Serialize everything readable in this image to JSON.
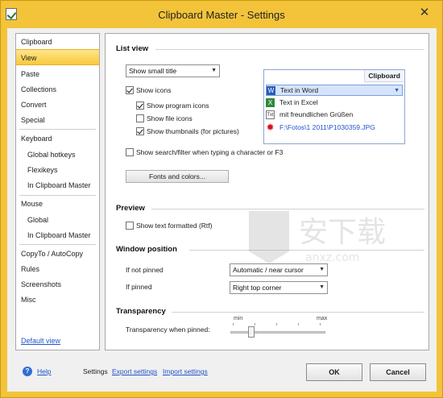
{
  "window": {
    "title": "Clipboard Master - Settings",
    "close_glyph": "✕"
  },
  "sidebar": {
    "items": [
      {
        "label": "Clipboard"
      },
      {
        "label": "View"
      },
      {
        "label": "Paste"
      },
      {
        "label": "Collections"
      },
      {
        "label": "Convert"
      },
      {
        "label": "Special"
      },
      {
        "label": "Keyboard"
      },
      {
        "label": "Global hotkeys"
      },
      {
        "label": "Flexikeys"
      },
      {
        "label": "In Clipboard Master"
      },
      {
        "label": "Mouse"
      },
      {
        "label": "Global"
      },
      {
        "label": "In Clipboard Master"
      },
      {
        "label": "CopyTo / AutoCopy"
      },
      {
        "label": "Rules"
      },
      {
        "label": "Screenshots"
      },
      {
        "label": "Misc"
      }
    ],
    "default_view": "Default view"
  },
  "list_view": {
    "title": "List view",
    "title_dropdown": "Show small title",
    "show_icons": "Show icons",
    "show_program_icons": "Show program icons",
    "show_file_icons": "Show file icons",
    "show_thumbnails": "Show thumbnails (for pictures)",
    "show_search": "Show search/filter when typing a character or F3",
    "fonts_button": "Fonts and colors..."
  },
  "preview_box": {
    "header": "Clipboard",
    "items": [
      {
        "text": "Text in Word",
        "icon": "word-icon"
      },
      {
        "text": "Text in Excel",
        "icon": "excel-icon"
      },
      {
        "text": "mit freundlichen Grüßen",
        "icon": "text-icon"
      },
      {
        "text": "F:\\Fotos\\1 2011\\P1030359.JPG",
        "icon": "paint-icon"
      }
    ]
  },
  "preview": {
    "title": "Preview",
    "show_text_formatted": "Show text formatted (Rtf)"
  },
  "window_position": {
    "title": "Window position",
    "if_not_pinned": "If not pinned",
    "if_not_pinned_value": "Automatic / near cursor",
    "if_pinned": "If pinned",
    "if_pinned_value": "Right top corner"
  },
  "transparency": {
    "title": "Transparency",
    "label": "Transparency when pinned:",
    "min": "min",
    "max": "max",
    "value": 0.2
  },
  "footer": {
    "help": "Help",
    "settings": "Settings",
    "export": "Export settings",
    "import": "Import settings",
    "ok": "OK",
    "cancel": "Cancel"
  },
  "watermark": {
    "text": "安下载",
    "sub": "anxz.com"
  }
}
